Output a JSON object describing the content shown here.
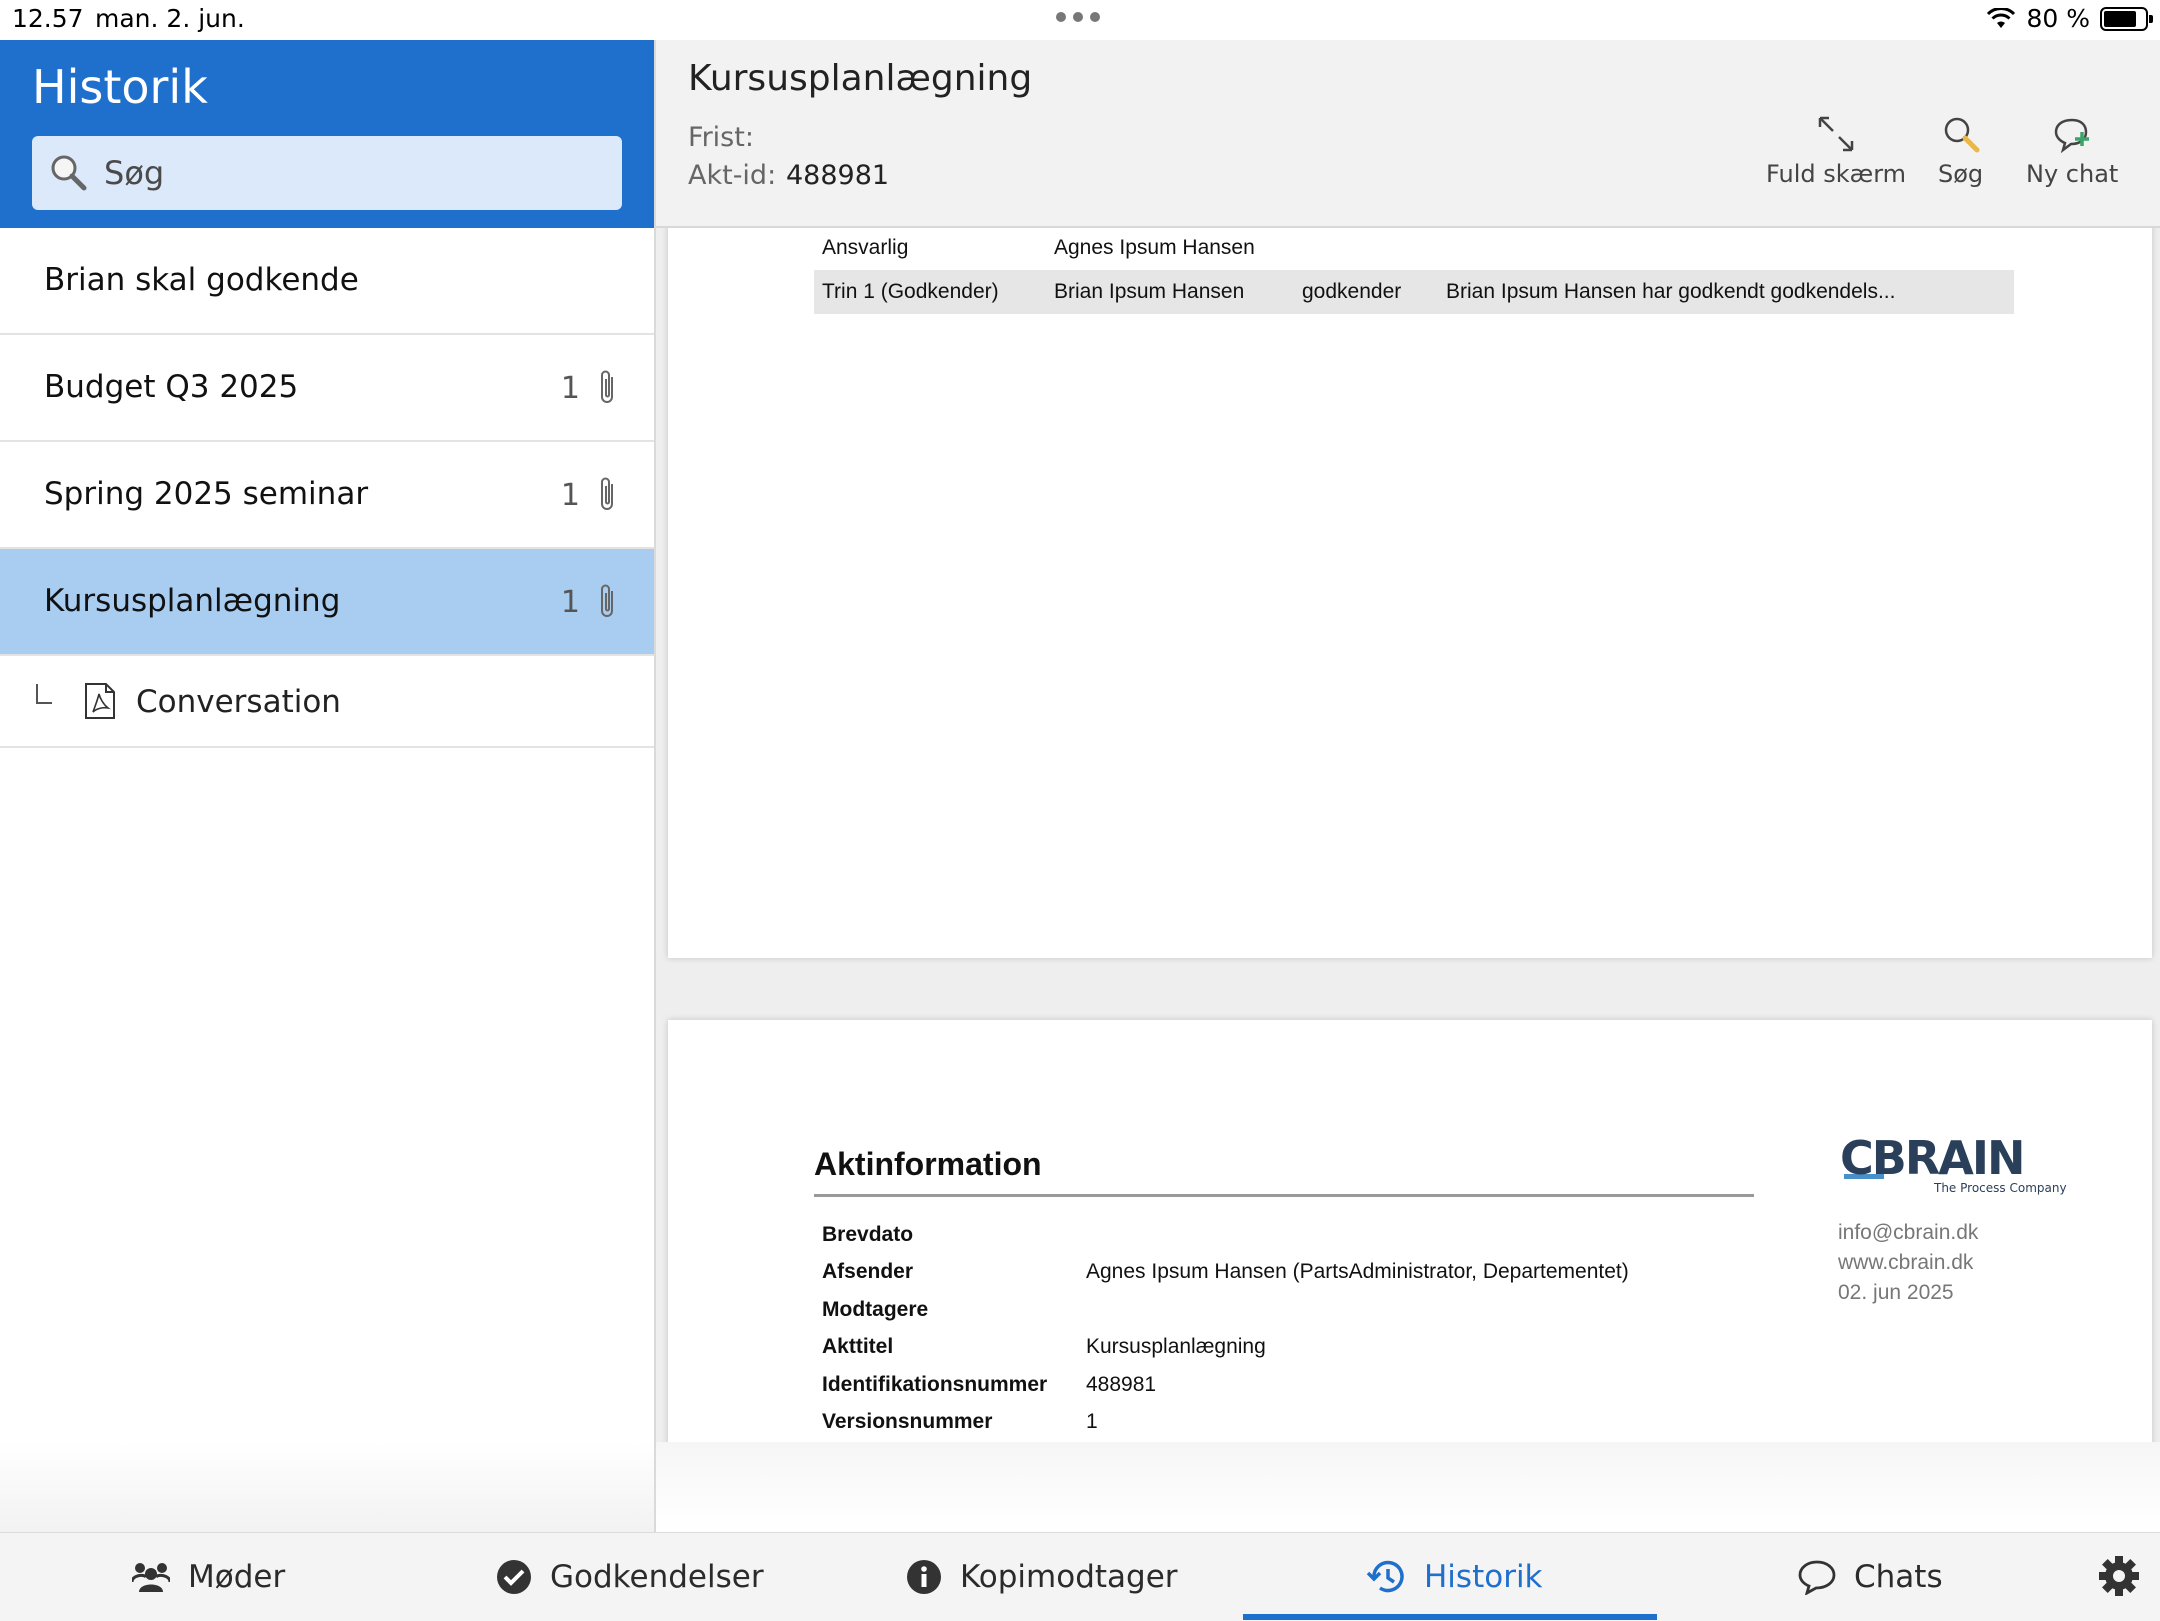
{
  "status_bar": {
    "time": "12.57",
    "date": "man. 2. jun.",
    "battery": "80 %",
    "battery_level": 0.8
  },
  "sidebar": {
    "title": "Historik",
    "search_placeholder": "Søg",
    "items": [
      {
        "label": "Brian skal godkende",
        "count": ""
      },
      {
        "label": "Budget Q3 2025",
        "count": "1"
      },
      {
        "label": "Spring 2025 seminar",
        "count": "1"
      },
      {
        "label": "Kursusplanlægning",
        "count": "1",
        "selected": true
      }
    ],
    "sub_item": {
      "label": "Conversation"
    }
  },
  "header": {
    "title": "Kursusplanlægning",
    "frist_label": "Frist:",
    "akt_label": "Akt-id:",
    "akt_value": "488981",
    "tools": {
      "fullscreen": "Fuld skærm",
      "search": "Søg",
      "new_chat": "Ny chat"
    }
  },
  "document": {
    "steps": [
      {
        "role": "Ansvarlig",
        "person": "Agnes Ipsum Hansen",
        "action": "",
        "note": ""
      },
      {
        "role": "Trin 1 (Godkender)",
        "person": "Brian Ipsum Hansen",
        "action": "godkender",
        "note": "Brian Ipsum Hansen har godkendt godkendels..."
      }
    ],
    "aktinformation": {
      "title": "Aktinformation",
      "rows": [
        {
          "key": "Brevdato",
          "value": ""
        },
        {
          "key": "Afsender",
          "value": "Agnes Ipsum Hansen (PartsAdministrator, Departementet)"
        },
        {
          "key": "Modtagere",
          "value": ""
        },
        {
          "key": "Akttitel",
          "value": "Kursusplanlægning"
        },
        {
          "key": "Identifikationsnummer",
          "value": "488981"
        },
        {
          "key": "Versionsnummer",
          "value": "1"
        }
      ]
    },
    "logo": {
      "name": "CBRAIN",
      "tagline": "The Process Company"
    },
    "contact": {
      "email": "info@cbrain.dk",
      "web": "www.cbrain.dk",
      "date": "02. jun 2025"
    }
  },
  "tabbar": {
    "tabs": [
      {
        "label": "Møder",
        "icon": "people-icon"
      },
      {
        "label": "Godkendelser",
        "icon": "check-circle-icon"
      },
      {
        "label": "Kopimodtager",
        "icon": "info-icon"
      },
      {
        "label": "Historik",
        "icon": "history-icon",
        "active": true
      },
      {
        "label": "Chats",
        "icon": "chat-bubble-icon"
      }
    ],
    "settings_icon": "gear-icon"
  },
  "colors": {
    "accent": "#1f6fcd",
    "selected_row": "#a9cdf1",
    "search_field": "#dce9fb"
  }
}
